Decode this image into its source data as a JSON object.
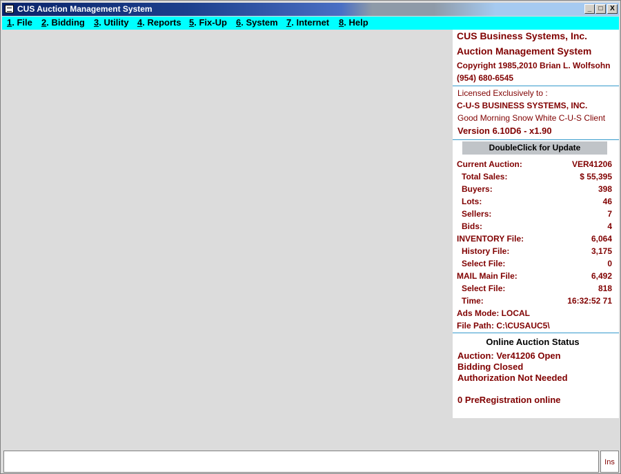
{
  "window": {
    "title": "CUS Auction Management System",
    "controls": {
      "minimize": "_",
      "restore": "□",
      "close": "X"
    }
  },
  "menu": [
    {
      "key": "1",
      "label": ". File"
    },
    {
      "key": "2",
      "label": ". Bidding"
    },
    {
      "key": "3",
      "label": ". Utility"
    },
    {
      "key": "4",
      "label": ". Reports"
    },
    {
      "key": "5",
      "label": ". Fix-Up"
    },
    {
      "key": "6",
      "label": ". System"
    },
    {
      "key": "7",
      "label": ". Internet"
    },
    {
      "key": "8",
      "label": ". Help"
    }
  ],
  "info": {
    "company": "CUS Business Systems, Inc.",
    "product": "Auction Management System",
    "copyright": "Copyright 1985,2010 Brian L. Wolfsohn",
    "phone": "(954) 680-6545",
    "licensed_label": "Licensed Exclusively to :",
    "licensee": "C-U-S BUSINESS SYSTEMS, INC.",
    "greeting": "Good Morning Snow White C-U-S Client",
    "version": "Version 6.10D6 - x1.90"
  },
  "update_button": "DoubleClick for Update",
  "stats": [
    {
      "label": "Current Auction:",
      "value": "VER41206",
      "indent": false
    },
    {
      "label": "Total Sales:",
      "value": "$ 55,395",
      "indent": true
    },
    {
      "label": "Buyers:",
      "value": "398",
      "indent": true
    },
    {
      "label": "Lots:",
      "value": "46",
      "indent": true
    },
    {
      "label": "Sellers:",
      "value": "7",
      "indent": true
    },
    {
      "label": "Bids:",
      "value": "4",
      "indent": true
    },
    {
      "label": "INVENTORY File:",
      "value": "6,064",
      "indent": false
    },
    {
      "label": "History File:",
      "value": "3,175",
      "indent": true
    },
    {
      "label": "Select File:",
      "value": "0",
      "indent": true
    },
    {
      "label": "MAIL Main File:",
      "value": "6,492",
      "indent": false
    },
    {
      "label": "Select File:",
      "value": "818",
      "indent": true
    },
    {
      "label": "Time:",
      "value": "16:32:52  71",
      "indent": true
    },
    {
      "label": "Ads Mode:  LOCAL",
      "value": "",
      "indent": false
    },
    {
      "label": "File Path:  C:\\CUSAUC5\\",
      "value": "",
      "indent": false
    }
  ],
  "online": {
    "heading": "Online Auction Status",
    "auction": "Auction: Ver41206 Open",
    "bidding": "Bidding Closed",
    "authorization": "Authorization Not Needed",
    "prereg": "0 PreRegistration online"
  },
  "statusbar": {
    "ins": "Ins"
  },
  "colors": {
    "accent": "#800000",
    "menubar": "#00ffff",
    "divider": "#3399cc"
  }
}
